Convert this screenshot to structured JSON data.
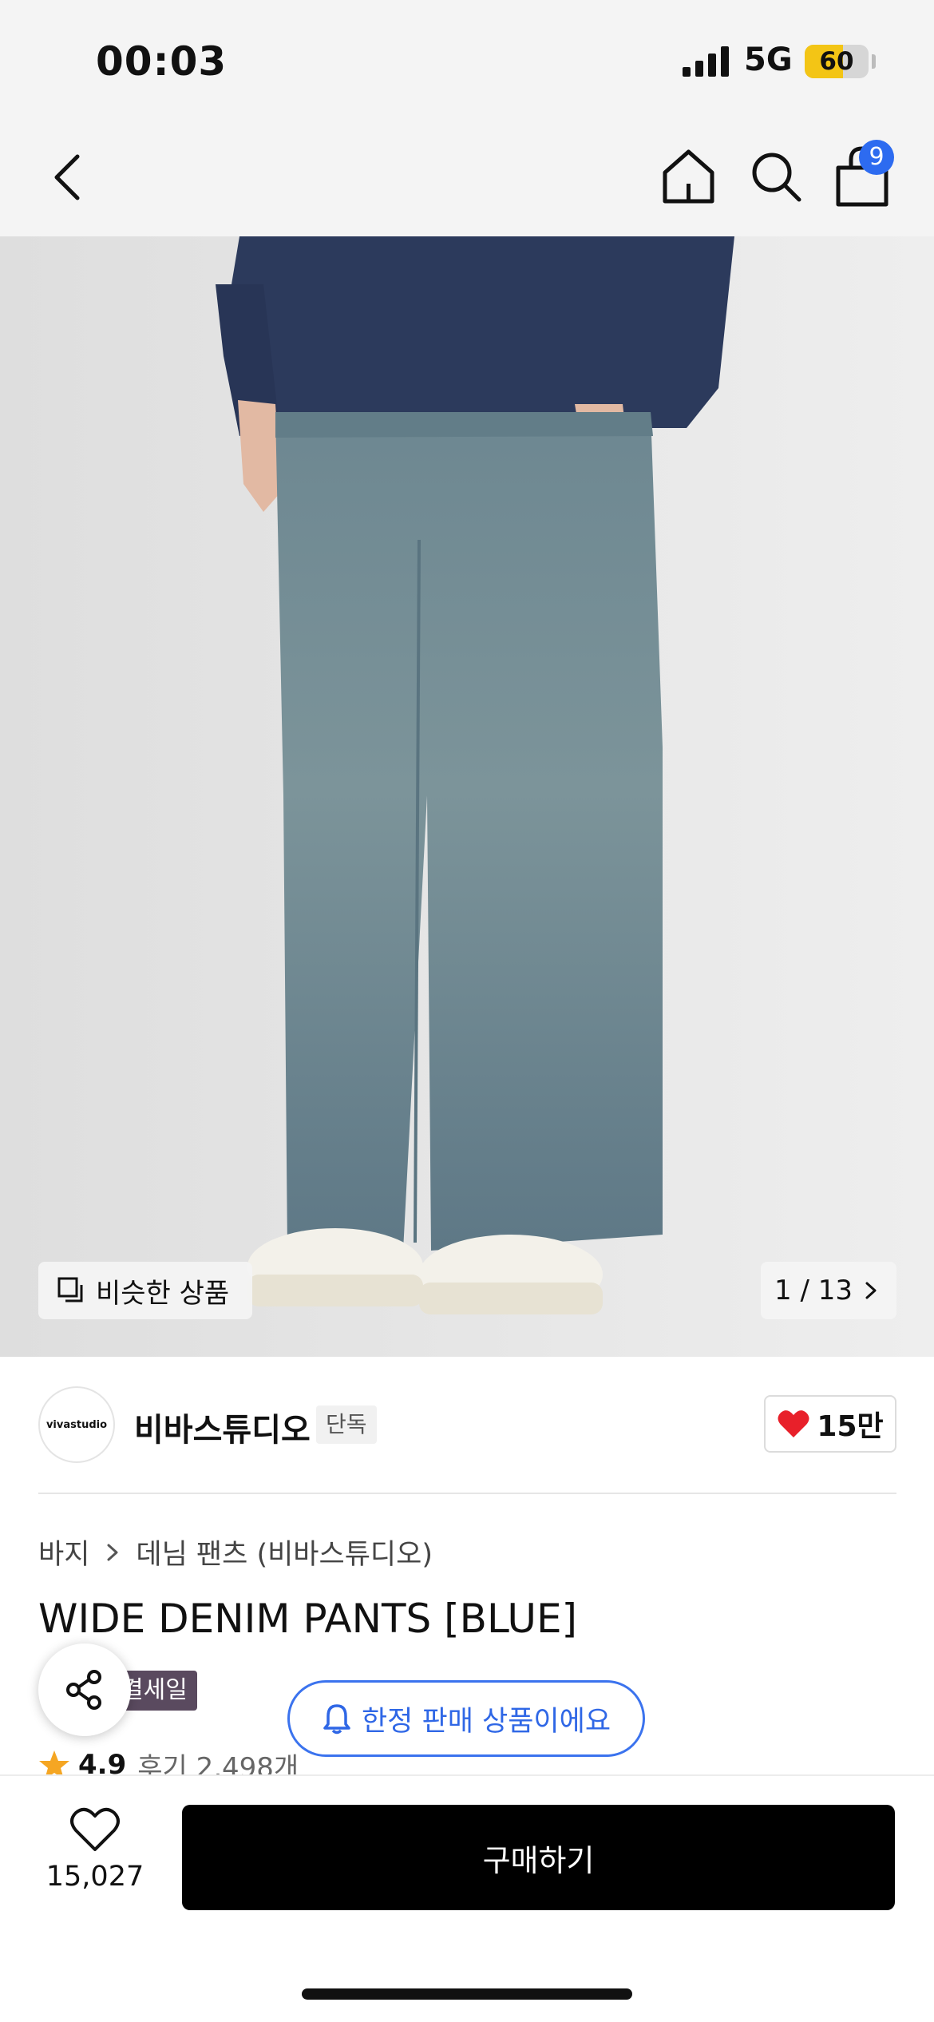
{
  "status_bar": {
    "time": "00:03",
    "network": "5G",
    "battery_level": "60",
    "battery_fraction": 0.6
  },
  "nav": {
    "back_icon": "chevron-left-icon",
    "home_icon": "home-icon",
    "search_icon": "search-icon",
    "cart_icon": "shopping-bag-icon",
    "cart_badge": "9"
  },
  "gallery": {
    "similar_label": "비슷한 상품",
    "pager": "1 / 13",
    "pager_icon": "chevron-right-icon"
  },
  "brand": {
    "logo_text": "vivastudio",
    "name": "비바스튜디오",
    "tag": "단독",
    "like_count": "15만",
    "like_icon": "heart-filled-icon",
    "like_color": "#e8202a"
  },
  "product": {
    "breadcrumb": [
      "바지",
      "데님 팬츠 (비바스튜디오)"
    ],
    "title": "WIDE DENIM PANTS [BLUE]",
    "sale_tag": "결세일",
    "limited_notice": "한정 판매 상품이에요",
    "limited_color": "#3b73ee",
    "rating": "4.9",
    "reviews": "후기 2,498개",
    "star_color": "#f5a623"
  },
  "bottom_bar": {
    "wish_count": "15,027",
    "wish_icon": "heart-outline-icon",
    "buy_label": "구매하기",
    "share_icon": "share-icon"
  }
}
